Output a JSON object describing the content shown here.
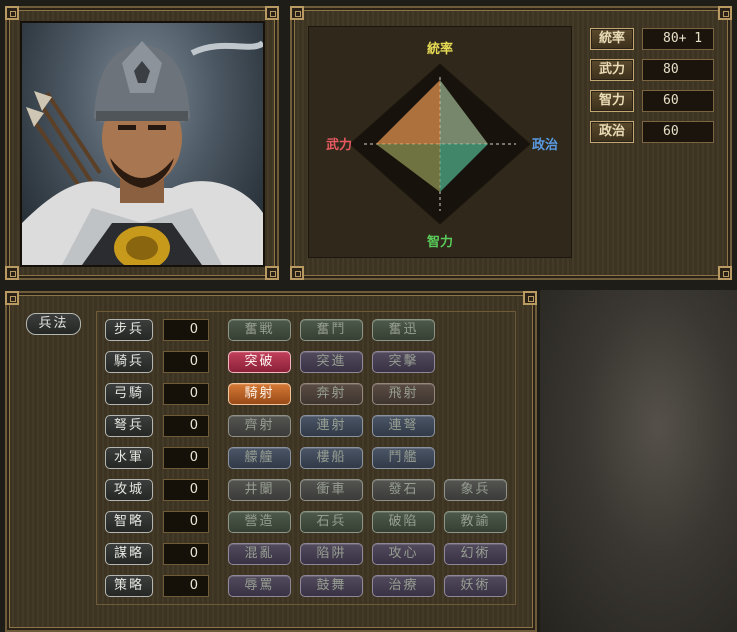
{
  "radar": {
    "top_label": "統率",
    "left_label": "武力",
    "right_label": "政治",
    "bottom_label": "智力",
    "values": {
      "統率": 80,
      "武力": 80,
      "智力": 60,
      "政治": 60
    },
    "colors": {
      "top": "#f0e04a",
      "left": "#e5505a",
      "right": "#4c8fe0",
      "bottom": "#52c050"
    }
  },
  "stats": [
    {
      "label": "統率",
      "value": "80+ 1"
    },
    {
      "label": "武力",
      "value": "80"
    },
    {
      "label": "智力",
      "value": "60"
    },
    {
      "label": "政治",
      "value": "60"
    }
  ],
  "tactics_title": "兵法",
  "units": [
    {
      "name": "步兵",
      "level": "0",
      "skills": [
        {
          "label": "奮戦",
          "state": "inactive",
          "tone": "green"
        },
        {
          "label": "奮鬥",
          "state": "inactive",
          "tone": "green"
        },
        {
          "label": "奮迅",
          "state": "inactive",
          "tone": "green"
        }
      ]
    },
    {
      "name": "騎兵",
      "level": "0",
      "skills": [
        {
          "label": "突破",
          "state": "active",
          "tone": "red"
        },
        {
          "label": "突進",
          "state": "inactive",
          "tone": "purple"
        },
        {
          "label": "突擊",
          "state": "inactive",
          "tone": "purple"
        }
      ]
    },
    {
      "name": "弓騎",
      "level": "0",
      "skills": [
        {
          "label": "騎射",
          "state": "active",
          "tone": "orange"
        },
        {
          "label": "奔射",
          "state": "inactive",
          "tone": "brown"
        },
        {
          "label": "飛射",
          "state": "inactive",
          "tone": "brown"
        }
      ]
    },
    {
      "name": "弩兵",
      "level": "0",
      "skills": [
        {
          "label": "齊射",
          "state": "inactive",
          "tone": "gray"
        },
        {
          "label": "連射",
          "state": "inactive",
          "tone": "blue"
        },
        {
          "label": "連弩",
          "state": "inactive",
          "tone": "blue"
        }
      ]
    },
    {
      "name": "水軍",
      "level": "0",
      "skills": [
        {
          "label": "艨艟",
          "state": "inactive",
          "tone": "blue"
        },
        {
          "label": "樓船",
          "state": "inactive",
          "tone": "blue"
        },
        {
          "label": "鬥艦",
          "state": "inactive",
          "tone": "blue"
        }
      ]
    },
    {
      "name": "攻城",
      "level": "0",
      "skills": [
        {
          "label": "井闌",
          "state": "inactive",
          "tone": "gray"
        },
        {
          "label": "衝車",
          "state": "inactive",
          "tone": "gray"
        },
        {
          "label": "發石",
          "state": "inactive",
          "tone": "gray"
        },
        {
          "label": "象兵",
          "state": "inactive",
          "tone": "gray"
        }
      ]
    },
    {
      "name": "智略",
      "level": "0",
      "skills": [
        {
          "label": "營造",
          "state": "inactive",
          "tone": "green"
        },
        {
          "label": "石兵",
          "state": "inactive",
          "tone": "green"
        },
        {
          "label": "破陷",
          "state": "inactive",
          "tone": "green"
        },
        {
          "label": "教諭",
          "state": "inactive",
          "tone": "green"
        }
      ]
    },
    {
      "name": "謀略",
      "level": "0",
      "skills": [
        {
          "label": "混亂",
          "state": "inactive",
          "tone": "purple"
        },
        {
          "label": "陷阱",
          "state": "inactive",
          "tone": "purple"
        },
        {
          "label": "攻心",
          "state": "inactive",
          "tone": "purple"
        },
        {
          "label": "幻術",
          "state": "inactive",
          "tone": "purple"
        }
      ]
    },
    {
      "name": "策略",
      "level": "0",
      "skills": [
        {
          "label": "辱罵",
          "state": "inactive",
          "tone": "purple"
        },
        {
          "label": "鼓舞",
          "state": "inactive",
          "tone": "purple"
        },
        {
          "label": "治療",
          "state": "inactive",
          "tone": "purple"
        },
        {
          "label": "妖術",
          "state": "inactive",
          "tone": "purple"
        }
      ]
    }
  ]
}
